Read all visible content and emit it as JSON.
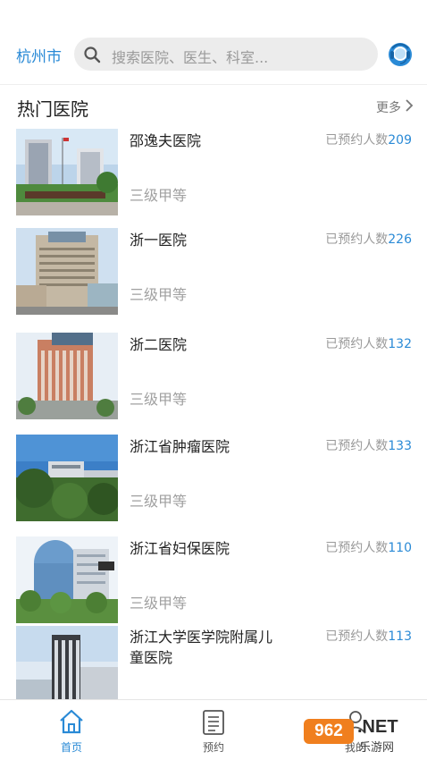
{
  "header": {
    "city": "杭州市",
    "search_placeholder": "搜索医院、医生、科室..."
  },
  "section": {
    "title": "热门医院",
    "more_label": "更多"
  },
  "hospitals": [
    {
      "name": "邵逸夫医院",
      "count_label": "已预约人数",
      "count": "209",
      "level": "三级甲等"
    },
    {
      "name": "浙一医院",
      "count_label": "已预约人数",
      "count": "226",
      "level": "三级甲等"
    },
    {
      "name": "浙二医院",
      "count_label": "已预约人数",
      "count": "132",
      "level": "三级甲等"
    },
    {
      "name": "浙江省肿瘤医院",
      "count_label": "已预约人数",
      "count": "133",
      "level": "三级甲等"
    },
    {
      "name": "浙江省妇保医院",
      "count_label": "已预约人数",
      "count": "110",
      "level": "三级甲等"
    },
    {
      "name": "浙江大学医学院附属儿童医院",
      "count_label": "已预约人数",
      "count": "113",
      "level": ""
    }
  ],
  "tabs": [
    {
      "label": "首页",
      "icon": "home-icon",
      "active": true
    },
    {
      "label": "预约",
      "icon": "clipboard-icon",
      "active": false
    },
    {
      "label": "我的",
      "icon": "user-icon",
      "active": false
    }
  ],
  "watermark": {
    "badge": "962",
    "net": ".NET",
    "cn": "乐游网"
  },
  "colors": {
    "accent": "#2a8ad6",
    "muted": "#9a9a9a",
    "watermark": "#f07f1e"
  }
}
